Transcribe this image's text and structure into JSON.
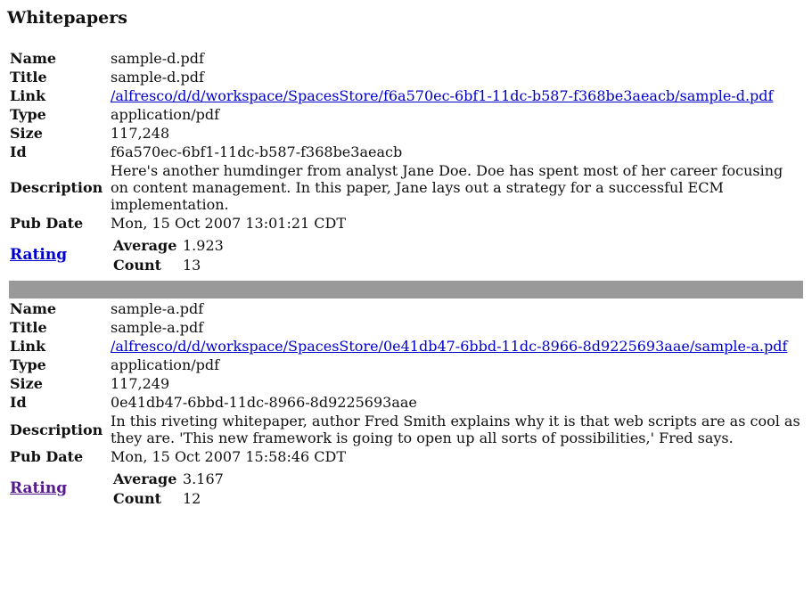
{
  "page": {
    "title": "Whitepapers"
  },
  "labels": {
    "name": "Name",
    "title": "Title",
    "link": "Link",
    "type": "Type",
    "size": "Size",
    "id": "Id",
    "description": "Description",
    "pub_date": "Pub Date",
    "rating": "Rating",
    "average": "Average",
    "count": "Count"
  },
  "papers": [
    {
      "name": "sample-d.pdf",
      "title": "sample-d.pdf",
      "link": "/alfresco/d/d/workspace/SpacesStore/f6a570ec-6bf1-11dc-b587-f368be3aeacb/sample-d.pdf",
      "type": "application/pdf",
      "size": "117,248",
      "id": "f6a570ec-6bf1-11dc-b587-f368be3aeacb",
      "description": "Here's another humdinger from analyst Jane Doe. Doe has spent most of her career focusing on content management. In this paper, Jane lays out a strategy for a successful ECM implementation.",
      "pub_date": "Mon, 15 Oct 2007 13:01:21 CDT",
      "rating_average": "1.923",
      "rating_count": "13"
    },
    {
      "name": "sample-a.pdf",
      "title": "sample-a.pdf",
      "link": "/alfresco/d/d/workspace/SpacesStore/0e41db47-6bbd-11dc-8966-8d9225693aae/sample-a.pdf",
      "type": "application/pdf",
      "size": "117,249",
      "id": "0e41db47-6bbd-11dc-8966-8d9225693aae",
      "description": "In this riveting whitepaper, author Fred Smith explains why it is that web scripts are as cool as they are. 'This new framework is going to open up all sorts of possibilities,' Fred says.",
      "pub_date": "Mon, 15 Oct 2007 15:58:46 CDT",
      "rating_average": "3.167",
      "rating_count": "12"
    }
  ]
}
